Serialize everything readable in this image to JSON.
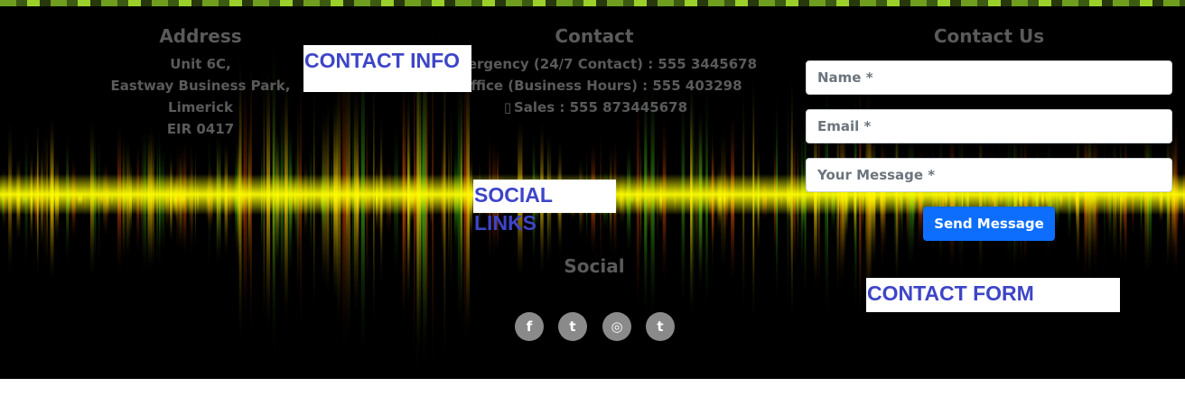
{
  "address": {
    "title": "Address",
    "lines": [
      "Unit 6C,",
      "Eastway Business Park,",
      "Limerick",
      "EIR 0417"
    ]
  },
  "contact": {
    "title": "Contact",
    "emergency": "Emergency (24/7 Contact) : 555 3445678",
    "office": "Office (Business Hours) : 555 403298",
    "sales": "Sales : 555 873445678",
    "icons": [
      "phone-icon",
      "phone-icon",
      "mobile-icon"
    ]
  },
  "contact_form": {
    "title": "Contact Us",
    "name_placeholder": "Name *",
    "email_placeholder": "Email *",
    "message_placeholder": "Your Message *",
    "submit_label": "Send Message"
  },
  "social": {
    "title": "Social",
    "links": [
      {
        "icon": "facebook-icon",
        "glyph": "f"
      },
      {
        "icon": "twitter-icon",
        "glyph": "t"
      },
      {
        "icon": "instagram-icon",
        "glyph": "◎"
      },
      {
        "icon": "tumblr-icon",
        "glyph": "t"
      }
    ]
  },
  "annotations": {
    "contact_info": "CONTACT INFO",
    "social_links": "SOCIAL LINKS",
    "contact_form": "CONTACT FORM"
  },
  "colors": {
    "button": "#0d6efd",
    "annotation_text": "#3d45c7",
    "heading_text": "#5a5a5a",
    "background": "#000000",
    "wave_yellow": "#ffff00"
  }
}
